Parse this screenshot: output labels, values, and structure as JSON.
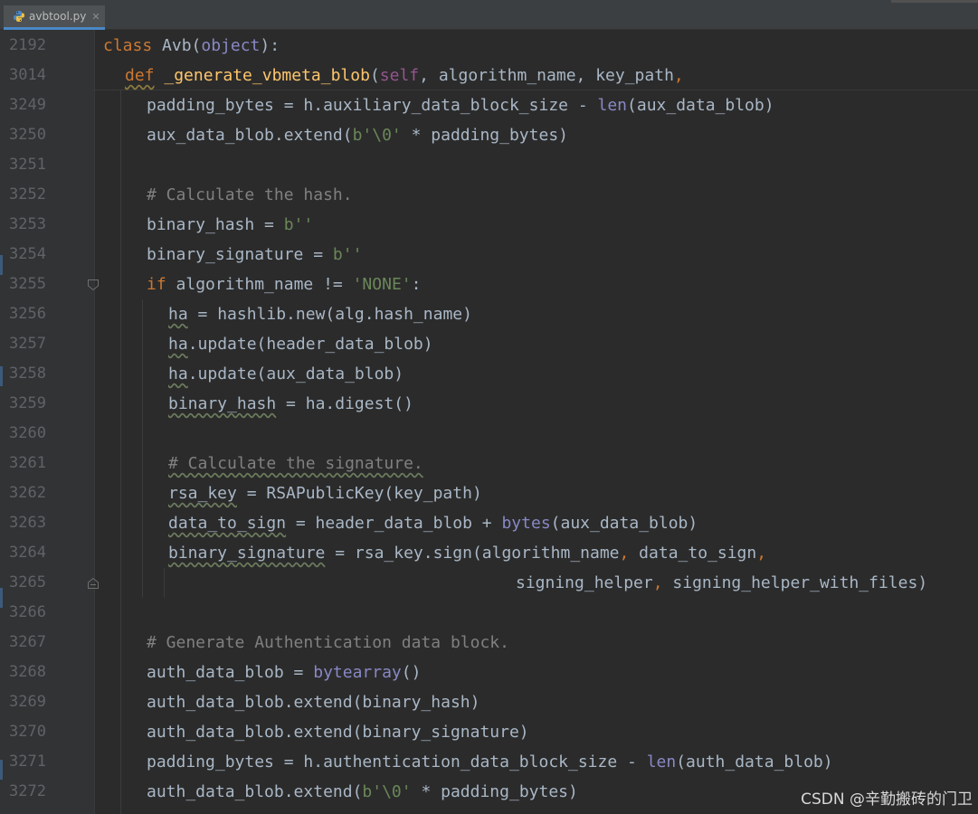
{
  "tab": {
    "file_name": "avbtool.py",
    "close_glyph": "✕",
    "icon": "python-file-icon"
  },
  "sticky": {
    "line1": {
      "num": "2192",
      "kw": "class",
      "rest": " Avb(",
      "bi": "object",
      "end": "):"
    },
    "line2": {
      "num": "3014",
      "kw": "def",
      "fn": "_generate_vbmeta_blob",
      "p1": "(",
      "self": "self",
      "rest": ", algorithm_name, key_path",
      "end": ","
    }
  },
  "lines": [
    {
      "num": "3249"
    },
    {
      "num": "3250"
    },
    {
      "num": "3251"
    },
    {
      "num": "3252"
    },
    {
      "num": "3253"
    },
    {
      "num": "3254"
    },
    {
      "num": "3255"
    },
    {
      "num": "3256"
    },
    {
      "num": "3257"
    },
    {
      "num": "3258"
    },
    {
      "num": "3259"
    },
    {
      "num": "3260"
    },
    {
      "num": "3261"
    },
    {
      "num": "3262"
    },
    {
      "num": "3263"
    },
    {
      "num": "3264"
    },
    {
      "num": "3265"
    },
    {
      "num": "3266"
    },
    {
      "num": "3267"
    },
    {
      "num": "3268"
    },
    {
      "num": "3269"
    },
    {
      "num": "3270"
    },
    {
      "num": "3271"
    },
    {
      "num": "3272"
    }
  ],
  "code": {
    "l3249": {
      "a": "padding_bytes = h.auxiliary_data_block_size - ",
      "bi": "len",
      "b": "(aux_data_blob)"
    },
    "l3250": {
      "a": "aux_data_blob.extend(",
      "st": "b'\\0'",
      "b": " * padding_bytes)"
    },
    "l3252": {
      "cm": "# Calculate the hash."
    },
    "l3253": {
      "a": "binary_hash = ",
      "st": "b''"
    },
    "l3254": {
      "a": "binary_signature = ",
      "st": "b''"
    },
    "l3255": {
      "kw": "if",
      "a": " algorithm_name != ",
      "st": "'NONE'",
      "b": ":"
    },
    "l3256": {
      "v": "ha",
      "a": " = hashlib.new(alg.hash_name)"
    },
    "l3257": {
      "v": "ha",
      "a": ".update(header_data_blob)"
    },
    "l3258": {
      "v": "ha",
      "a": ".update(aux_data_blob)"
    },
    "l3259": {
      "v": "binary_hash",
      "a": " = ha.digest()"
    },
    "l3261": {
      "cm": "# Calculate the signature."
    },
    "l3262": {
      "v": "rsa_key",
      "a": " = RSAPublicKey(key_path)"
    },
    "l3263": {
      "v": "data_to_sign",
      "a": " = header_data_blob + ",
      "bi": "bytes",
      "b": "(aux_data_blob)"
    },
    "l3264": {
      "v": "binary_signature",
      "a": " = rsa_key.sign(algorithm_name",
      "kw": ",",
      "b": " data_to_sign",
      "kw2": ","
    },
    "l3265": {
      "a": "signing_helper",
      "kw": ",",
      "b": " signing_helper_with_files)"
    },
    "l3267": {
      "cm": "# Generate Authentication data block."
    },
    "l3268": {
      "a": "auth_data_blob = ",
      "bi": "bytearray",
      "b": "()"
    },
    "l3269": {
      "a": "auth_data_blob.extend(binary_hash)"
    },
    "l3270": {
      "a": "auth_data_blob.extend(binary_signature)"
    },
    "l3271": {
      "a": "padding_bytes = h.authentication_data_block_size - ",
      "bi": "len",
      "b": "(auth_data_blob)"
    },
    "l3272": {
      "a": "auth_data_blob.extend(",
      "st": "b'\\0'",
      "b": " * padding_bytes)"
    }
  },
  "watermark": "CSDN @辛勤搬砖的门卫",
  "colors": {
    "background": "#2b2b2b",
    "gutter": "#313335",
    "keyword": "#cc7832",
    "function": "#ffc66d",
    "builtin": "#8888c6",
    "self": "#94558d",
    "string": "#6a8759",
    "comment": "#808080",
    "text": "#a9b7c6",
    "line_number": "#606366"
  }
}
